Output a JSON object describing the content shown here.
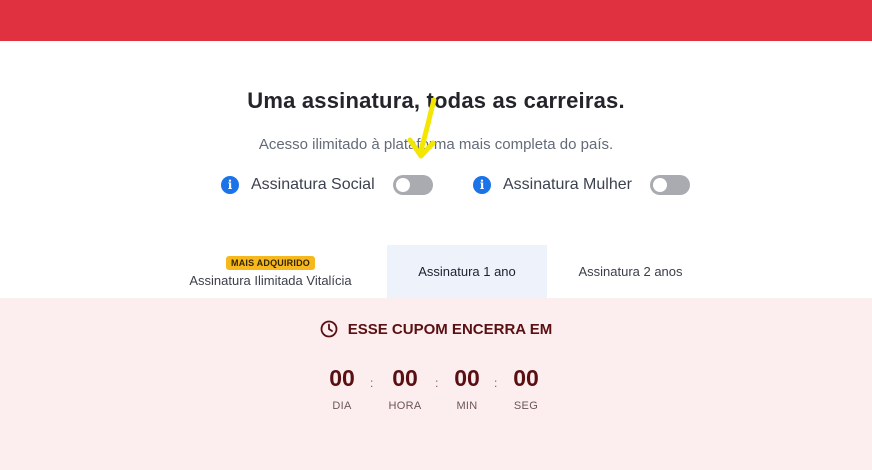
{
  "header": {
    "bar_color": "#e03140"
  },
  "hero": {
    "title": "Uma assinatura, todas as carreiras.",
    "subtitle": "Acesso ilimitado à plataforma mais completa do país."
  },
  "toggles": [
    {
      "label": "Assinatura Social",
      "icon": "info-icon",
      "on": false
    },
    {
      "label": "Assinatura Mulher",
      "icon": "info-icon",
      "on": false
    }
  ],
  "tabs": [
    {
      "badge": "MAIS ADQUIRIDO",
      "label": "Assinatura Ilimitada Vitalícia",
      "selected": false
    },
    {
      "label": "Assinatura 1 ano",
      "selected": true
    },
    {
      "label": "Assinatura 2 anos",
      "selected": false
    }
  ],
  "coupon": {
    "icon": "clock-icon",
    "title": "ESSE CUPOM ENCERRA EM",
    "countdown": [
      {
        "value": "00",
        "unit": "DIA"
      },
      {
        "value": "00",
        "unit": "HORA"
      },
      {
        "value": "00",
        "unit": "MIN"
      },
      {
        "value": "00",
        "unit": "SEG"
      }
    ],
    "separator": ":"
  },
  "colors": {
    "accent_red": "#e03140",
    "info_blue": "#1a73e8",
    "badge_yellow": "#f6b81d",
    "coupon_bg": "#fceeee",
    "coupon_text": "#5a0f12",
    "annotation": "#f3e600"
  }
}
